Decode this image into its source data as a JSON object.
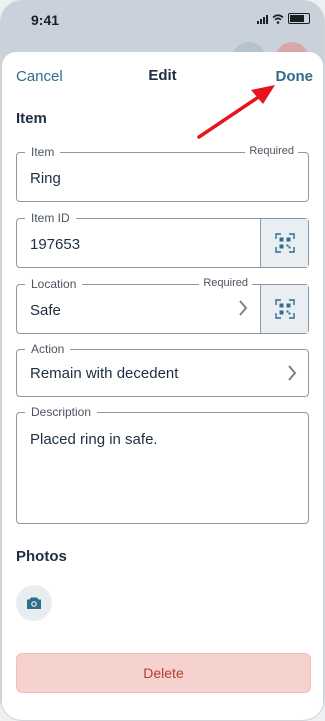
{
  "status_bar": {
    "time": "9:41"
  },
  "nav": {
    "cancel_label": "Cancel",
    "title": "Edit",
    "done_label": "Done"
  },
  "item_section": {
    "title": "Item",
    "item": {
      "label": "Item",
      "required": "Required",
      "value": "Ring"
    },
    "item_id": {
      "label": "Item ID",
      "value": "197653"
    },
    "location": {
      "label": "Location",
      "required": "Required",
      "value": "Safe"
    },
    "action": {
      "label": "Action",
      "value": "Remain with decedent"
    },
    "description": {
      "label": "Description",
      "value": "Placed ring in safe."
    }
  },
  "photos_section": {
    "title": "Photos",
    "add_photo_icon": "camera-icon"
  },
  "delete_label": "Delete",
  "annotation": {
    "arrow_color": "#e8141c",
    "points_to": "done-button"
  },
  "colors": {
    "accent": "#2f6d8a",
    "title": "#1f2e44",
    "danger_bg": "#f5d2cd",
    "danger_text": "#b53d33"
  }
}
